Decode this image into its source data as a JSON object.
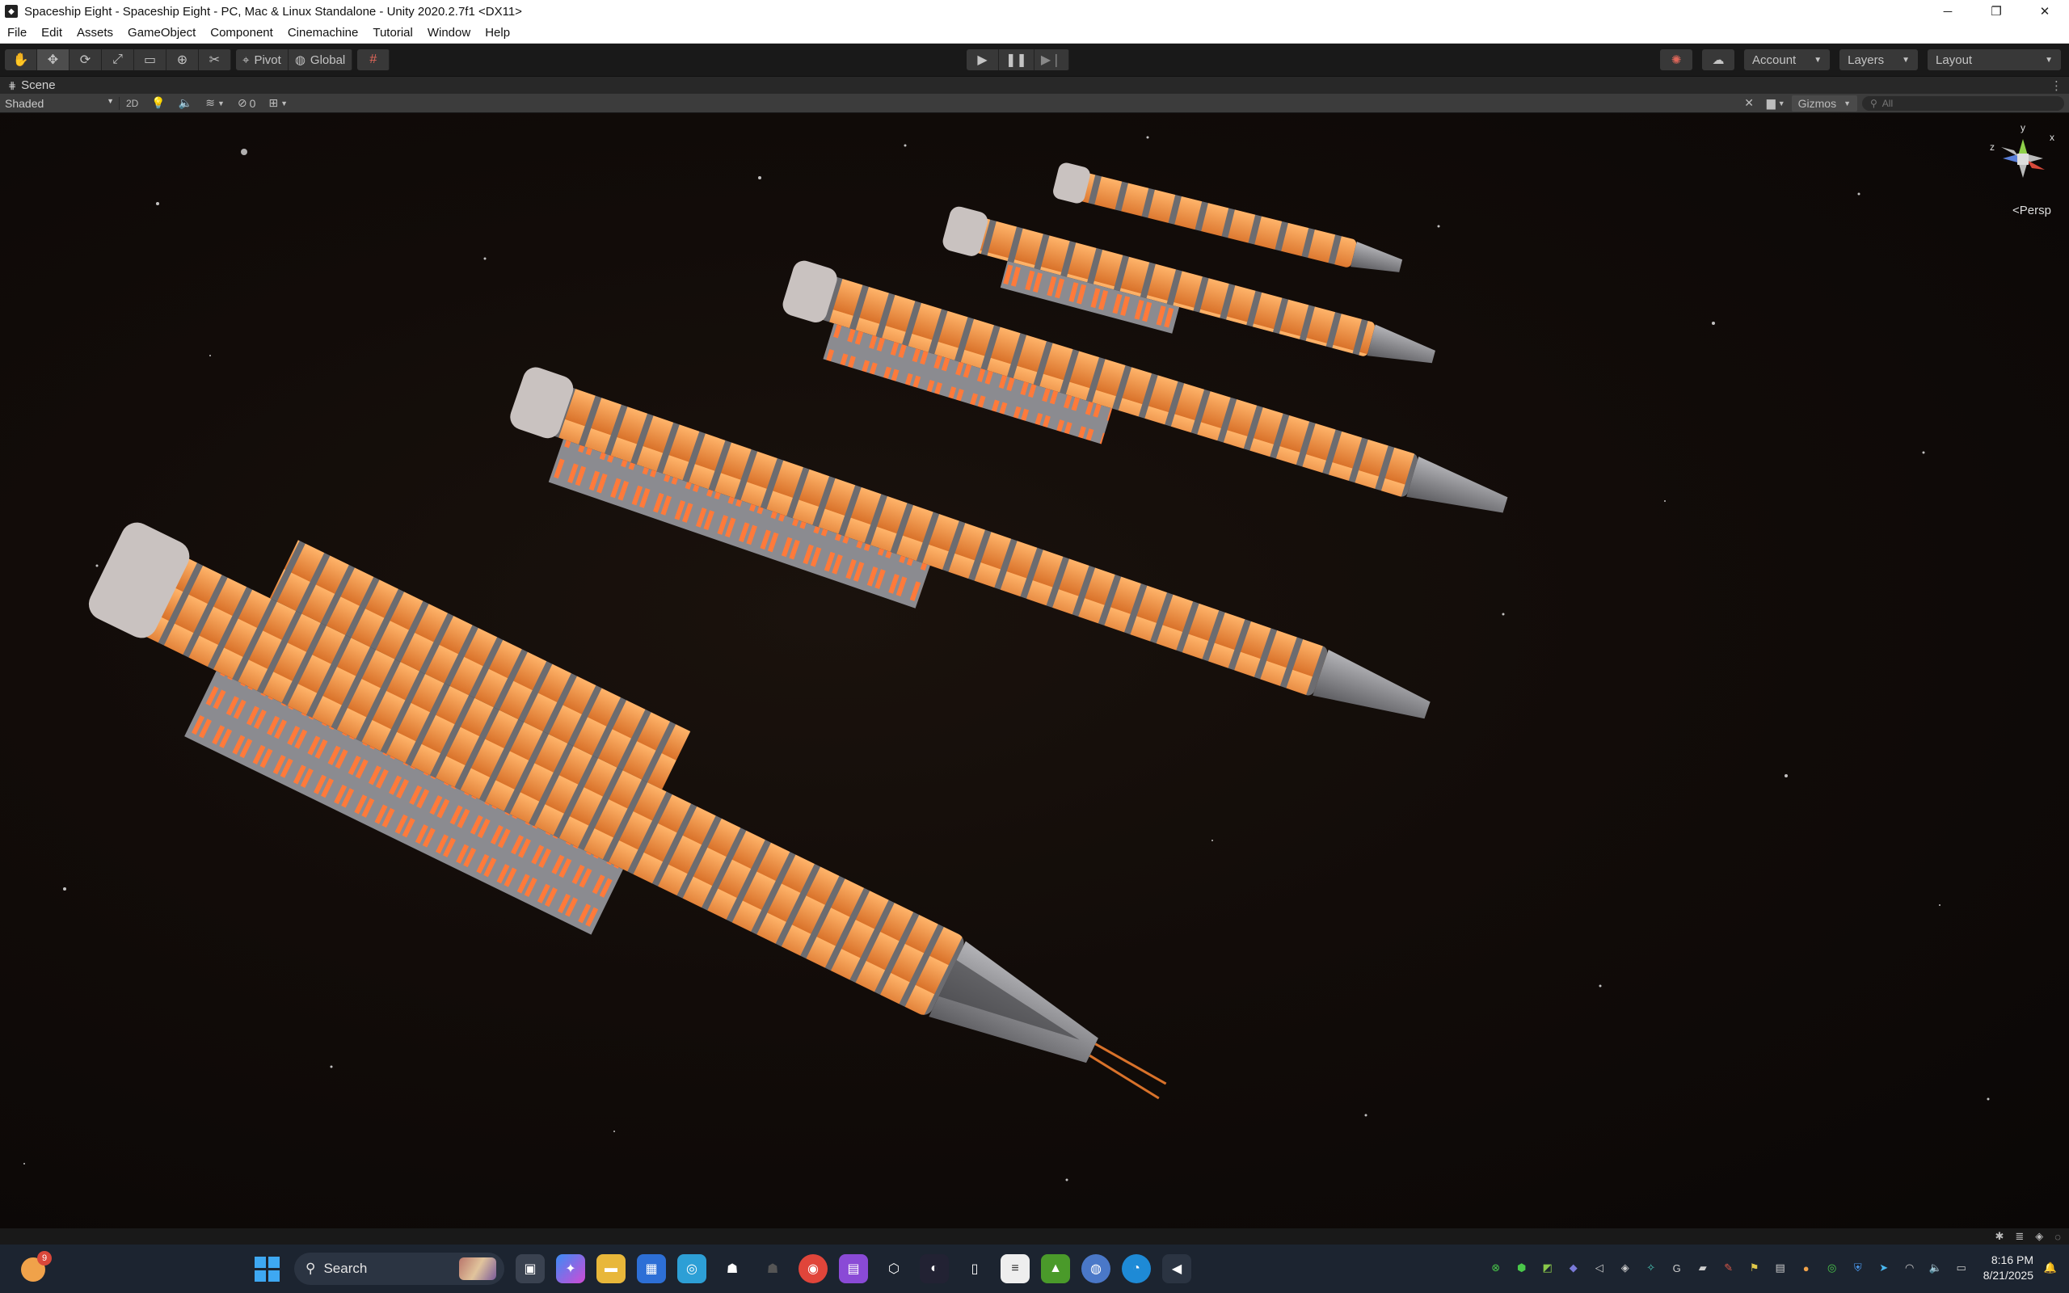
{
  "window": {
    "title": "Spaceship Eight - Spaceship Eight - PC, Mac & Linux Standalone - Unity 2020.2.7f1 <DX11>",
    "controls": {
      "minimize": "─",
      "maximize": "❐",
      "close": "✕"
    }
  },
  "menu": [
    "File",
    "Edit",
    "Assets",
    "GameObject",
    "Component",
    "Cinemachine",
    "Tutorial",
    "Window",
    "Help"
  ],
  "toolbar": {
    "tools": [
      "hand-tool",
      "move-tool",
      "rotate-tool",
      "scale-tool",
      "rect-tool",
      "transform-tool",
      "custom-tool"
    ],
    "pivot_label": "Pivot",
    "global_label": "Global",
    "account_label": "Account",
    "layers_label": "Layers",
    "layout_label": "Layout"
  },
  "scene_tab": {
    "label": "Scene"
  },
  "scene_bar": {
    "shading_mode": "Shaded",
    "mode_2d": "2D",
    "hidden_count": "0",
    "gizmos_label": "Gizmos",
    "search_placeholder": "All"
  },
  "gizmo": {
    "projection": "<Persp",
    "y": "y",
    "x": "x",
    "z": "z"
  },
  "taskbar": {
    "search_label": "Search",
    "notification_count": "9",
    "time": "8:16 PM",
    "date": "8/21/2025"
  },
  "colors": {
    "hull_glow": "#f0923c",
    "hull_metal": "#8e8e93",
    "editor_bg": "#191919",
    "start_blue": "#3ea8f2"
  }
}
